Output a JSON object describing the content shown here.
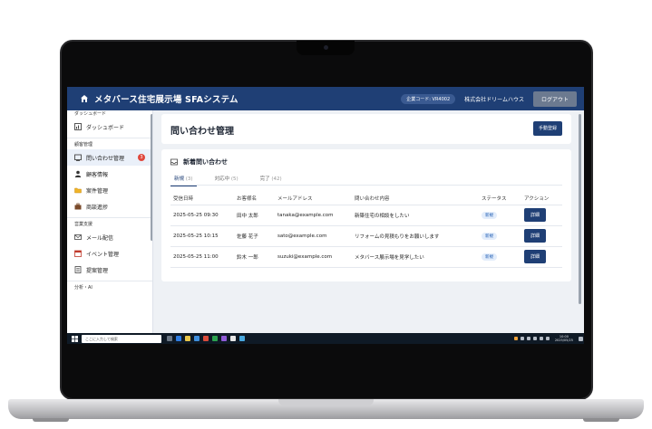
{
  "app": {
    "title": "メタバース住宅展示場 SFAシステム",
    "company_code": "企業コード: VR4002",
    "company_name": "株式会社ドリームハウス",
    "logout_label": "ログアウト"
  },
  "sidebar": {
    "sections": [
      {
        "label": "ダッシュボード",
        "items": [
          {
            "label": "ダッシュボード",
            "icon": "dashboard-icon"
          }
        ]
      },
      {
        "label": "顧客管理",
        "items": [
          {
            "label": "問い合わせ管理",
            "icon": "inquiry-icon",
            "active": true,
            "badge": "3"
          },
          {
            "label": "顧客情報",
            "icon": "customer-icon"
          },
          {
            "label": "案件管理",
            "icon": "folder-icon"
          },
          {
            "label": "商談進捗",
            "icon": "briefcase-icon"
          }
        ]
      },
      {
        "label": "営業支援",
        "items": [
          {
            "label": "メール配信",
            "icon": "mail-icon"
          },
          {
            "label": "イベント管理",
            "icon": "calendar-icon"
          },
          {
            "label": "提案管理",
            "icon": "document-icon"
          }
        ]
      },
      {
        "label": "分析・AI",
        "items": []
      }
    ]
  },
  "page": {
    "title": "問い合わせ管理",
    "manual_button": "手動登録"
  },
  "inquiries": {
    "card_title": "新着問い合わせ",
    "tabs": [
      {
        "label": "新規",
        "count": "(3)",
        "active": true
      },
      {
        "label": "対応中",
        "count": "(5)",
        "active": false
      },
      {
        "label": "完了",
        "count": "(42)",
        "active": false
      }
    ],
    "columns": [
      "受信日時",
      "お客様名",
      "メールアドレス",
      "問い合わせ内容",
      "ステータス",
      "アクション"
    ],
    "rows": [
      {
        "received": "2025-05-25 09:30",
        "name": "田中 太郎",
        "email": "tanaka@example.com",
        "content": "新築住宅の相談をしたい",
        "status": "新規",
        "action": "詳細"
      },
      {
        "received": "2025-05-25 10:15",
        "name": "佐藤 花子",
        "email": "sato@example.com",
        "content": "リフォームの見積もりをお願いします",
        "status": "新規",
        "action": "詳細"
      },
      {
        "received": "2025-05-25 11:00",
        "name": "鈴木 一郎",
        "email": "suzuki@example.com",
        "content": "メタバース展示場を見学したい",
        "status": "新規",
        "action": "詳細"
      }
    ]
  },
  "taskbar": {
    "search_placeholder": "ここに入力して検索",
    "clock_time": "10:00",
    "clock_date": "2025/05/25"
  },
  "colors": {
    "brand": "#1f3f75",
    "badge": "#e0463b",
    "status_bg": "#e3edfb"
  }
}
